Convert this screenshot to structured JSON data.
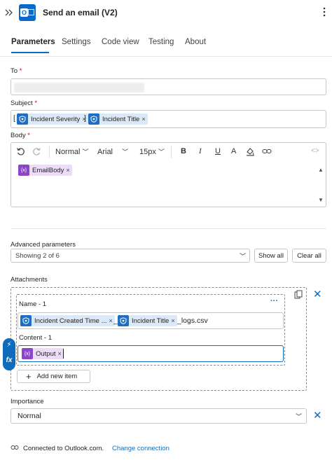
{
  "header": {
    "title": "Send an email (V2)",
    "expand_icon": "chevron-double-right-icon",
    "app_icon": "outlook-icon",
    "more_icon": "more-vertical-icon"
  },
  "tabs": [
    {
      "label": "Parameters",
      "active": true
    },
    {
      "label": "Settings"
    },
    {
      "label": "Code view"
    },
    {
      "label": "Testing"
    },
    {
      "label": "About"
    }
  ],
  "to": {
    "label": "To",
    "required_mark": "*"
  },
  "subject": {
    "label": "Subject",
    "required_mark": "*",
    "open_bracket": "[",
    "close_bracket": "]",
    "tokens": [
      "Incident Severity",
      "Incident Title"
    ]
  },
  "body": {
    "label": "Body",
    "required_mark": "*",
    "toolbar": {
      "font_style": "Normal",
      "font_family": "Arial",
      "font_size": "15px"
    },
    "token": "EmailBody"
  },
  "advanced": {
    "label": "Advanced parameters",
    "select_value": "Showing 2 of 6",
    "show_all": "Show all",
    "clear_all": "Clear all"
  },
  "attachments": {
    "label": "Attachments",
    "name_label": "Name - 1",
    "name_tokens": [
      "Incident Created Time ...",
      "Incident Title"
    ],
    "underscore": "_",
    "name_suffix": "_logs.csv",
    "content_label": "Content - 1",
    "content_token": "Output",
    "add_item": "Add new item",
    "more_dots": "···"
  },
  "importance": {
    "label": "Importance",
    "value": "Normal"
  },
  "footer": {
    "connected_text": "Connected to Outlook.com.",
    "change_link": "Change connection"
  },
  "colors": {
    "accent": "#0f6cbd",
    "sentinel_token": "#dbe8f7",
    "variable_token": "#ecdcf8",
    "required": "#c50f1f"
  }
}
